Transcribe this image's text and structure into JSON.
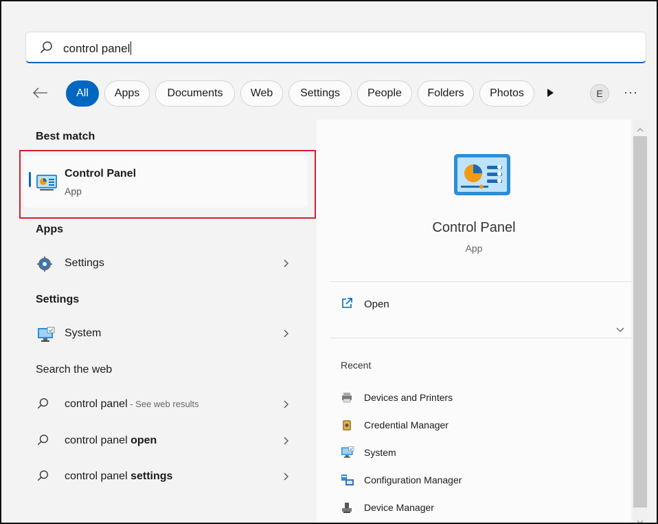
{
  "search": {
    "value": "control panel"
  },
  "filters": {
    "chips": [
      "All",
      "Apps",
      "Documents",
      "Web",
      "Settings",
      "People",
      "Folders",
      "Photos"
    ],
    "active": "All",
    "avatar_letter": "E",
    "more": "···"
  },
  "left": {
    "best_match_heading": "Best match",
    "best_match": {
      "title": "Control Panel",
      "subtitle": "App"
    },
    "apps_heading": "Apps",
    "apps": [
      {
        "label": "Settings"
      }
    ],
    "settings_heading": "Settings",
    "settings": [
      {
        "label": "System"
      }
    ],
    "web_heading": "Search the web",
    "web": [
      {
        "query": "control panel",
        "suffix": " - See web results"
      },
      {
        "query": "control panel",
        "bold": " open"
      },
      {
        "query": "control panel",
        "bold": " settings"
      }
    ]
  },
  "right": {
    "title": "Control Panel",
    "subtitle": "App",
    "open_label": "Open",
    "recent_heading": "Recent",
    "recent": [
      {
        "label": "Devices and Printers",
        "icon": "printer-icon"
      },
      {
        "label": "Credential Manager",
        "icon": "vault-icon"
      },
      {
        "label": "System",
        "icon": "monitor-icon"
      },
      {
        "label": "Configuration Manager",
        "icon": "config-icon"
      },
      {
        "label": "Device Manager",
        "icon": "device-manager-icon"
      }
    ]
  },
  "colors": {
    "accent": "#0067c0",
    "highlight_box": "#d0202f"
  }
}
